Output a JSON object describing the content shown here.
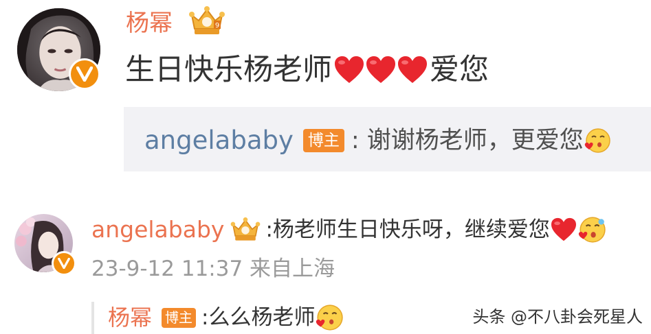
{
  "comment_main": {
    "author": "杨幂",
    "author_badge_icon": "crown-badge-icon",
    "text": "生日快乐杨老师",
    "hearts_count": 3,
    "text_suffix": "爱您",
    "reply": {
      "author": "angelababy",
      "role_tag": "博主",
      "text": ": 谢谢杨老师，更爱您",
      "emoji_icon": "kiss-emoji-icon"
    }
  },
  "comment_second": {
    "author": "angelababy",
    "author_badge_icon": "crown-badge-icon",
    "text": ":杨老师生日快乐呀，继续爱您",
    "emoji_icons": [
      "heart-icon",
      "kiss-emoji-icon"
    ],
    "meta": "23-9-12 11:37 来自上海",
    "reply": {
      "author": "杨幂",
      "role_tag": "博主",
      "text": ":么么杨老师",
      "emoji_icon": "kiss-emoji-icon"
    }
  },
  "watermark": "头条 @不八卦会死星人",
  "colors": {
    "name_orange": "#eb7350",
    "link_blue": "#5d7ea3",
    "badge_orange": "#f38a2c",
    "heart_red": "#e8262e",
    "reply_bg": "#f2f2f5",
    "meta_gray": "#9a9a9a"
  }
}
